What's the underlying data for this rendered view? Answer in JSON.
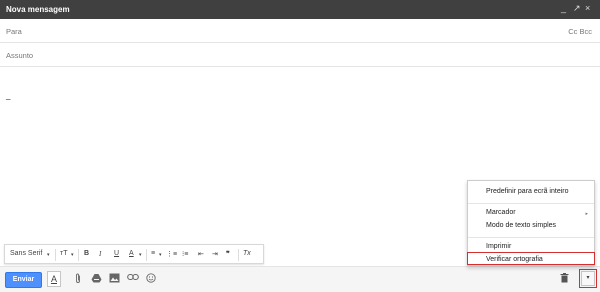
{
  "window": {
    "title": "Nova mensagem",
    "controls": [
      "_",
      "↗",
      "×"
    ]
  },
  "to_field": {
    "label": "Para",
    "cc_bcc": "Cc Bcc"
  },
  "subject_field": {
    "label": "Assunto"
  },
  "body": {
    "text": "_"
  },
  "format_toolbar": {
    "font": "Sans Serif",
    "font_arrow": "▾",
    "size": "ᴛT",
    "size_arrow": "▾",
    "bold": "B",
    "italic": "I",
    "underline": "U",
    "text_color": "A",
    "color_arrow": "▾",
    "align": "≡",
    "align_arrow": "▾",
    "numbered_list": "⋮≡",
    "bulleted_list": "⁝≡",
    "indent_less": "⇤",
    "indent_more": "⇥",
    "quote": "❞",
    "remove_format": "Tx"
  },
  "bottom_toolbar": {
    "send_label": "Enviar",
    "formatting": "A",
    "more_options": "▾"
  },
  "menu": {
    "items": [
      {
        "label": "Predefinir para ecrã inteiro"
      },
      {
        "label": "Marcador",
        "submenu_arrow": "▸"
      },
      {
        "label": "Modo de texto simples"
      },
      {
        "label": "Imprimir"
      },
      {
        "label": "Verificar ortografia"
      }
    ]
  },
  "colors": {
    "titlebar": "#404040",
    "send_button": "#4d90fe",
    "highlight": "#d32f2f"
  }
}
